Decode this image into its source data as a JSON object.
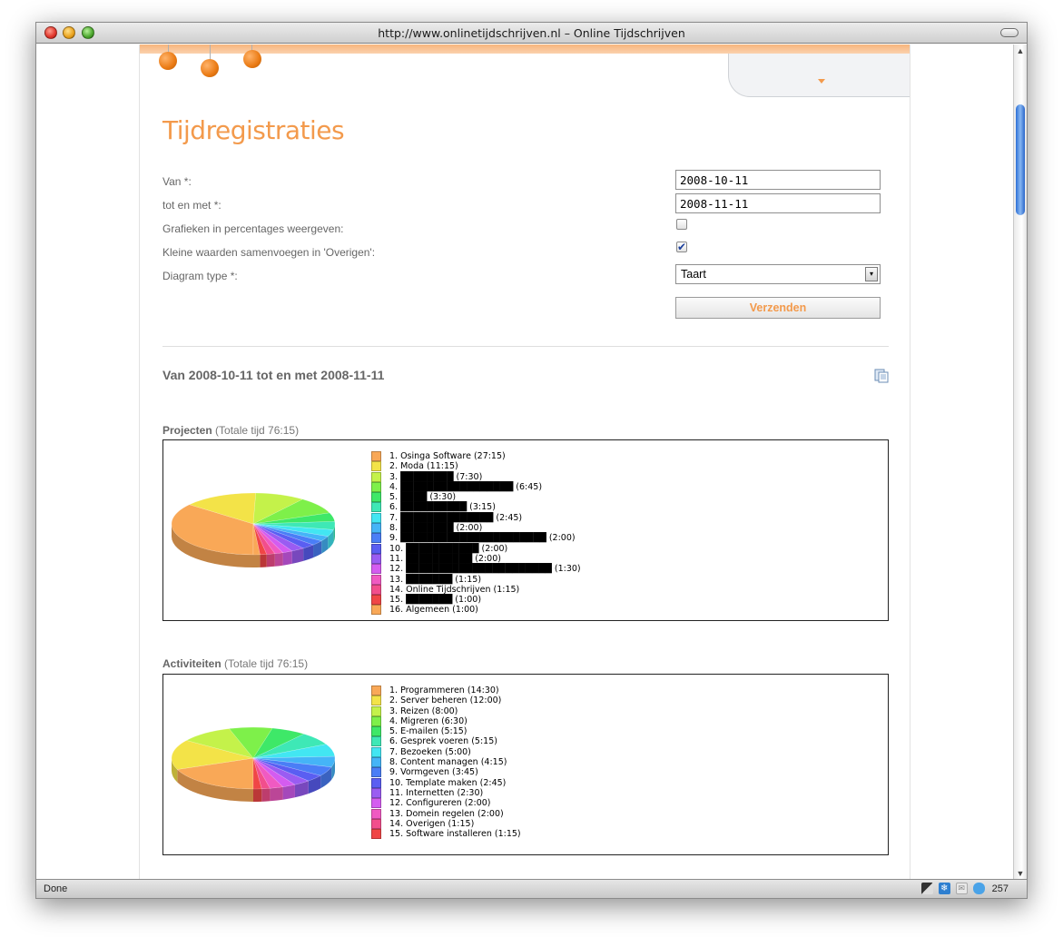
{
  "browser": {
    "title": "http://www.onlinetijdschrijven.nl – Online Tijdschrijven",
    "status": "Done",
    "status_count": "257"
  },
  "page": {
    "heading": "Tijdregistraties",
    "form": {
      "van_label": "Van *:",
      "van_value": "2008-10-11",
      "tot_label": "tot en met *:",
      "tot_value": "2008-11-11",
      "percent_label": "Grafieken in percentages weergeven:",
      "percent_checked": false,
      "merge_label": "Kleine waarden samenvoegen in 'Overigen':",
      "merge_checked": true,
      "type_label": "Diagram type *:",
      "type_value": "Taart",
      "submit_label": "Verzenden"
    },
    "range_title": "Van 2008-10-11 tot en met 2008-11-11"
  },
  "colors": {
    "accent": "#f39a4c",
    "palette": [
      "#f9a857",
      "#f3e348",
      "#c4f24a",
      "#7ef04a",
      "#3ee868",
      "#3ee8b6",
      "#42e6f2",
      "#45b4f7",
      "#4a7ef6",
      "#5a5ef2",
      "#9a5cf2",
      "#d45cf0",
      "#f05ac2",
      "#f24e8c",
      "#f04646"
    ]
  },
  "charts": [
    {
      "caption_bold": "Projecten",
      "caption_rest": " (Totale tijd 76:15)",
      "chart_data": {
        "type": "pie",
        "title": "Projecten",
        "total": "76:15",
        "labels": [
          "1. Osinga Software (27:15)",
          "2. Moda (11:15)",
          "3. ████████ (7:30)",
          "4. █████████████████ (6:45)",
          "5. ████ (3:30)",
          "6. ██████████ (3:15)",
          "7. ██████████████ (2:45)",
          "8. ████████ (2:00)",
          "9. ██████████████████████ (2:00)",
          "10. ███████████ (2:00)",
          "11. ██████████ (2:00)",
          "12. ██████████████████████ (1:30)",
          "13. ███████ (1:15)",
          "14. Online Tijdschrijven (1:15)",
          "15. ███████ (1:00)",
          "16. Algemeen (1:00)"
        ],
        "values_hours": [
          27.25,
          11.25,
          7.5,
          6.75,
          3.5,
          3.25,
          2.75,
          2.0,
          2.0,
          2.0,
          2.0,
          1.5,
          1.25,
          1.25,
          1.0,
          1.0
        ]
      }
    },
    {
      "caption_bold": "Activiteiten",
      "caption_rest": " (Totale tijd 76:15)",
      "chart_data": {
        "type": "pie",
        "title": "Activiteiten",
        "total": "76:15",
        "labels": [
          "1. Programmeren (14:30)",
          "2. Server beheren (12:00)",
          "3. Reizen (8:00)",
          "4. Migreren (6:30)",
          "5. E-mailen (5:15)",
          "6. Gesprek voeren (5:15)",
          "7. Bezoeken (5:00)",
          "8. Content managen (4:15)",
          "9. Vormgeven (3:45)",
          "10. Template maken (2:45)",
          "11. Internetten (2:30)",
          "12. Configureren (2:00)",
          "13. Domein regelen (2:00)",
          "14. Overigen (1:15)",
          "15. Software installeren (1:15)"
        ],
        "values_hours": [
          14.5,
          12.0,
          8.0,
          6.5,
          5.25,
          5.25,
          5.0,
          4.25,
          3.75,
          2.75,
          2.5,
          2.0,
          2.0,
          1.25,
          1.25
        ]
      }
    }
  ]
}
